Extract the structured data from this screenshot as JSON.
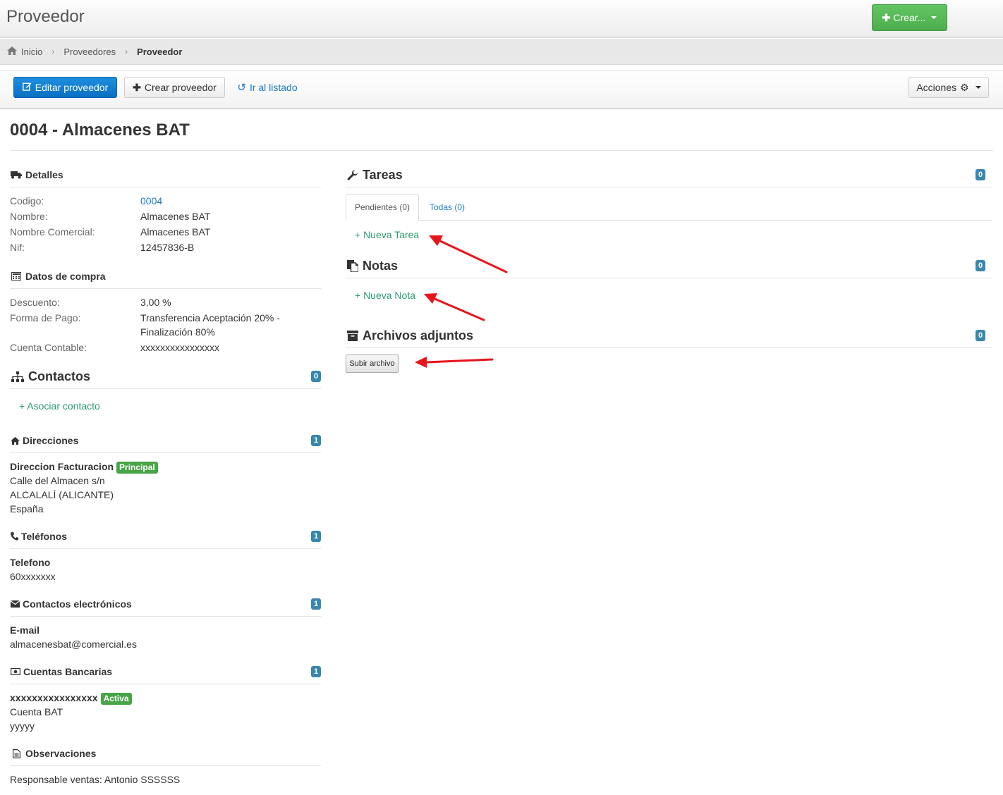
{
  "header": {
    "title": "Proveedor",
    "create_button": "Crear..."
  },
  "breadcrumb": [
    "Inicio",
    "Proveedores",
    "Proveedor"
  ],
  "toolbar": {
    "edit": "Editar proveedor",
    "create": "Crear proveedor",
    "list": "Ir al listado",
    "actions": "Acciones"
  },
  "page_title": "0004 - Almacenes BAT",
  "detalles": {
    "heading": "Detalles",
    "rows": [
      {
        "k": "Codigo:",
        "v": "0004"
      },
      {
        "k": "Nombre:",
        "v": "Almacenes BAT"
      },
      {
        "k": "Nombre Comercial:",
        "v": "Almacenes BAT"
      },
      {
        "k": "Nif:",
        "v": "12457836-B"
      }
    ]
  },
  "compra": {
    "heading": "Datos de compra",
    "rows": [
      {
        "k": "Descuento:",
        "v": "3,00 %"
      },
      {
        "k": "Forma de Pago:",
        "v": "Transferencia Aceptación 20% -",
        "v2": "Finalización 80%"
      },
      {
        "k": "Cuenta Contable:",
        "v": "xxxxxxxxxxxxxxxx"
      }
    ]
  },
  "contactos": {
    "heading": "Contactos",
    "count": "0",
    "link": "+ Asociar contacto"
  },
  "direcciones": {
    "heading": "Direcciones",
    "count": "1",
    "name": "Direccion Facturacion",
    "label": "Principal",
    "lines": [
      "Calle del Almacen s/n",
      "ALCALALÍ (ALICANTE)",
      "España"
    ]
  },
  "telefonos": {
    "heading": "Teléfonos",
    "count": "1",
    "name": "Telefono",
    "value": "60xxxxxxx"
  },
  "electronicos": {
    "heading": "Contactos electrónicos",
    "count": "1",
    "name": "E-mail",
    "value": "almacenesbat@comercial.es"
  },
  "cuentas": {
    "heading": "Cuentas Bancarias",
    "count": "1",
    "name": "xxxxxxxxxxxxxxxx",
    "label": "Activa",
    "lines": [
      "Cuenta BAT",
      "yyyyy"
    ]
  },
  "observaciones": {
    "heading": "Observaciones",
    "text": "Responsable ventas: Antonio SSSSSS"
  },
  "tareas": {
    "heading": "Tareas",
    "count": "0",
    "tabs": [
      "Pendientes (0)",
      "Todas (0)"
    ],
    "link": "+ Nueva Tarea"
  },
  "notas": {
    "heading": "Notas",
    "count": "0",
    "link": "+ Nueva Nota"
  },
  "archivos": {
    "heading": "Archivos adjuntos",
    "count": "0",
    "button": "Subir archivo"
  },
  "colors": {
    "primary": "#0a6fc4",
    "success": "#4cae4c",
    "badge": "#3a87ad",
    "link_green": "#2d9a6e",
    "annotation": "#e8141b"
  }
}
